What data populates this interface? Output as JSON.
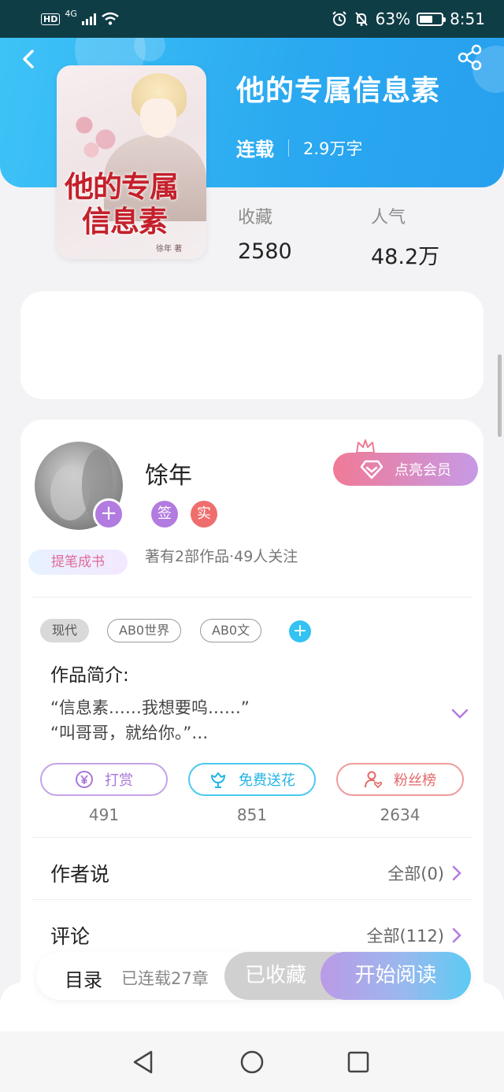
{
  "status_bar": {
    "hd": "HD",
    "network": "4G",
    "battery": "63%",
    "battery_level": 0.63,
    "time": "8:51"
  },
  "book": {
    "title": "他的专属信息素",
    "status": "连载",
    "word_count": "2.9万字",
    "cover_title_line1": "他的专属",
    "cover_title_line2": "信息素",
    "cover_author": "徐年 著"
  },
  "stats": [
    {
      "label": "收藏",
      "value": "2580"
    },
    {
      "label": "人气",
      "value": "48.2万"
    }
  ],
  "author": {
    "name": "馀年",
    "badge": "提笔成书",
    "sign_tag": "签",
    "real_tag": "实",
    "works_info": "著有2部作品·49人关注",
    "vip_label": "点亮会员"
  },
  "tags": [
    "现代",
    "AB0世界",
    "AB0文"
  ],
  "intro": {
    "title": "作品简介:",
    "line1": "“信息素……我想要呜……”",
    "line2": "“叫哥哥，就给你。”…"
  },
  "actions": [
    {
      "label": "打赏",
      "count": "491"
    },
    {
      "label": "免费送花",
      "count": "851"
    },
    {
      "label": "粉丝榜",
      "count": "2634"
    }
  ],
  "rows": [
    {
      "title": "作者说",
      "link": "全部(0)"
    },
    {
      "title": "评论",
      "link": "全部(112)"
    }
  ],
  "bottom_bar": {
    "catalog": "目录",
    "chapters": "已连载27章",
    "collected": "已收藏",
    "read": "开始阅读"
  },
  "colors": {
    "header_blue": "#2aa8f0",
    "purple_accent": "#b27be0",
    "red_accent": "#ef6d6d",
    "cyan_accent": "#33c2f2"
  },
  "icons": [
    "back-arrow-icon",
    "share-icon",
    "diamond-icon",
    "crown-icon",
    "yen-coin-icon",
    "flower-icon",
    "person-heart-icon",
    "chevron-down-icon",
    "chevron-right-icon",
    "plus-icon"
  ]
}
